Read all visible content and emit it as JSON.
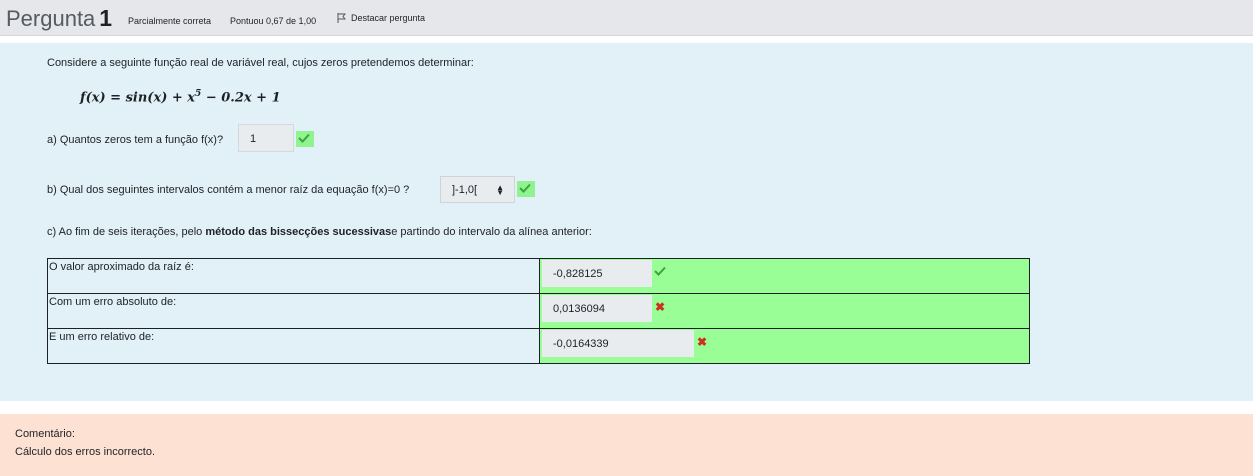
{
  "header": {
    "question_label": "Pergunta",
    "question_number": "1",
    "state": "Parcialmente correta",
    "grade": "Pontuou 0,67 de 1,00",
    "flag_label": "Destacar pergunta"
  },
  "question": {
    "prompt": "Considere a seguinte função real de variável real, cujos zeros pretendemos determinar:",
    "formula_lhs": "f(x) = sin(x) + x",
    "formula_exp": "5",
    "formula_rhs": " − 0.2x + 1",
    "part_a": {
      "label": "a) Quantos zeros tem a função f(x)?",
      "answer": "1",
      "status": "correct"
    },
    "part_b": {
      "label": "b) Qual dos seguintes intervalos contém a menor raíz da equação f(x)=0 ?",
      "selected": "]-1,0[",
      "status": "correct"
    },
    "part_c": {
      "prefix": "c) Ao fim de seis iterações, pelo ",
      "bold": "método das bissecções sucessivas",
      "suffix": "e partindo do intervalo da alínea anterior:",
      "rows": [
        {
          "label": "O valor aproximado da raíz é:",
          "value": "-0,828125",
          "status": "correct"
        },
        {
          "label": "Com um erro absoluto de:",
          "value": "0,0136094",
          "status": "incorrect"
        },
        {
          "label": "E um erro relativo de:",
          "value": "-0,0164339",
          "status": "incorrect"
        }
      ]
    }
  },
  "feedback": {
    "title": "Comentário:",
    "text": "Cálculo dos erros incorrecto."
  },
  "colors": {
    "correct": "#9afe96",
    "incorrect_mark": "#ca3120",
    "content_bg": "#e1f1f7",
    "feedback_bg": "#fde2d3"
  }
}
